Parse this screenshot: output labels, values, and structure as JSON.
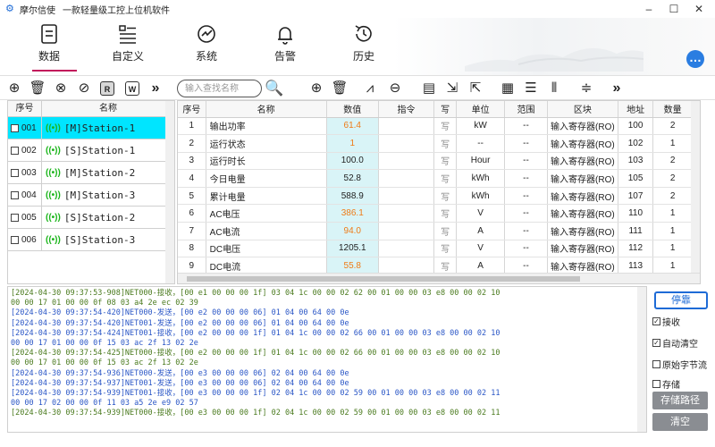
{
  "window": {
    "app_name": "摩尔信使",
    "subtitle": "一款轻量级工控上位机软件",
    "controls": [
      "–",
      "☐",
      "✕"
    ]
  },
  "nav": {
    "items": [
      {
        "label": "数据",
        "icon": "data-doc-icon",
        "active": true
      },
      {
        "label": "自定义",
        "icon": "custom-list-icon",
        "active": false
      },
      {
        "label": "系统",
        "icon": "system-gauge-icon",
        "active": false
      },
      {
        "label": "告警",
        "icon": "bell-icon",
        "active": false
      },
      {
        "label": "历史",
        "icon": "history-clock-icon",
        "active": false
      }
    ]
  },
  "toolbar": {
    "search_placeholder": "输入查找名称",
    "left_icons": [
      "add-icon",
      "delete-icon",
      "close-circle-icon",
      "check-circle-icon",
      "r-box-icon",
      "w-box-icon",
      "more-icon"
    ],
    "right_icons": [
      "add-icon",
      "delete-icon",
      "waveform-icon",
      "zoom-icon",
      "doc-icon",
      "import-icon",
      "export-icon",
      "grid-icon",
      "list-icon",
      "columns-icon",
      "sliders-icon",
      "more-icon"
    ]
  },
  "stations": {
    "headers": {
      "index": "序号",
      "name": "名称"
    },
    "rows": [
      {
        "index": "001",
        "name": "[M]Station-1",
        "selected": true
      },
      {
        "index": "002",
        "name": "[S]Station-1",
        "selected": false
      },
      {
        "index": "003",
        "name": "[M]Station-2",
        "selected": false
      },
      {
        "index": "004",
        "name": "[M]Station-3",
        "selected": false
      },
      {
        "index": "005",
        "name": "[S]Station-2",
        "selected": false
      },
      {
        "index": "006",
        "name": "[S]Station-3",
        "selected": false
      }
    ],
    "signal_glyph": "((•))"
  },
  "registers": {
    "headers": [
      "序号",
      "名称",
      "数值",
      "指令",
      "写",
      "单位",
      "范围",
      "区块",
      "地址",
      "数量"
    ],
    "rows": [
      {
        "no": "1",
        "name": "输出功率",
        "value": "61.4",
        "cmd": "",
        "write": "写",
        "unit": "kW",
        "range": "--",
        "block": "输入寄存器(RO)",
        "addr": "100",
        "qty": "2",
        "color": "orange"
      },
      {
        "no": "2",
        "name": "运行状态",
        "value": "1",
        "cmd": "",
        "write": "写",
        "unit": "--",
        "range": "--",
        "block": "输入寄存器(RO)",
        "addr": "102",
        "qty": "1",
        "color": "orange"
      },
      {
        "no": "3",
        "name": "运行时长",
        "value": "100.0",
        "cmd": "",
        "write": "写",
        "unit": "Hour",
        "range": "--",
        "block": "输入寄存器(RO)",
        "addr": "103",
        "qty": "2",
        "color": "dark"
      },
      {
        "no": "4",
        "name": "今日电量",
        "value": "52.8",
        "cmd": "",
        "write": "写",
        "unit": "kWh",
        "range": "--",
        "block": "输入寄存器(RO)",
        "addr": "105",
        "qty": "2",
        "color": "dark"
      },
      {
        "no": "5",
        "name": "累计电量",
        "value": "588.9",
        "cmd": "",
        "write": "写",
        "unit": "kWh",
        "range": "--",
        "block": "输入寄存器(RO)",
        "addr": "107",
        "qty": "2",
        "color": "dark"
      },
      {
        "no": "6",
        "name": "AC电压",
        "value": "386.1",
        "cmd": "",
        "write": "写",
        "unit": "V",
        "range": "--",
        "block": "输入寄存器(RO)",
        "addr": "110",
        "qty": "1",
        "color": "orange"
      },
      {
        "no": "7",
        "name": "AC电流",
        "value": "94.0",
        "cmd": "",
        "write": "写",
        "unit": "A",
        "range": "--",
        "block": "输入寄存器(RO)",
        "addr": "111",
        "qty": "1",
        "color": "orange"
      },
      {
        "no": "8",
        "name": "DC电压",
        "value": "1205.1",
        "cmd": "",
        "write": "写",
        "unit": "V",
        "range": "--",
        "block": "输入寄存器(RO)",
        "addr": "112",
        "qty": "1",
        "color": "dark"
      },
      {
        "no": "9",
        "name": "DC电流",
        "value": "55.8",
        "cmd": "",
        "write": "写",
        "unit": "A",
        "range": "--",
        "block": "输入寄存器(RO)",
        "addr": "113",
        "qty": "1",
        "color": "orange"
      }
    ]
  },
  "log": {
    "lines": [
      {
        "kind": "rx",
        "text": "[2024-04-30 09:37:53-908]NET000-接收，[00 e1 00 00 00 1f] 03 04 1c 00 00 02 62 00 01 00 00 03 e8 00 00 02 10"
      },
      {
        "kind": "rx",
        "text": "00 00 17 01 00 00 0f 08 03 a4 2e ec 02 39"
      },
      {
        "kind": "tx",
        "text": "[2024-04-30 09:37:54-420]NET000-发送，[00 e2 00 00 00 06] 01 04 00 64 00 0e"
      },
      {
        "kind": "tx",
        "text": "[2024-04-30 09:37:54-420]NET001-发送，[00 e2 00 00 00 06] 01 04 00 64 00 0e"
      },
      {
        "kind": "tx",
        "text": "[2024-04-30 09:37:54-424]NET001-接收，[00 e2 00 00 00 1f] 01 04 1c 00 00 02 66 00 01 00 00 03 e8 00 00 02 10"
      },
      {
        "kind": "tx",
        "text": "00 00 17 01 00 00 0f 15 03 ac 2f 13 02 2e"
      },
      {
        "kind": "rx",
        "text": "[2024-04-30 09:37:54-425]NET000-接收，[00 e2 00 00 00 1f] 01 04 1c 00 00 02 66 00 01 00 00 03 e8 00 00 02 10"
      },
      {
        "kind": "rx",
        "text": "00 00 17 01 00 00 0f 15 03 ac 2f 13 02 2e"
      },
      {
        "kind": "tx",
        "text": "[2024-04-30 09:37:54-936]NET000-发送，[00 e3 00 00 00 06] 02 04 00 64 00 0e"
      },
      {
        "kind": "tx",
        "text": "[2024-04-30 09:37:54-937]NET001-发送，[00 e3 00 00 00 06] 02 04 00 64 00 0e"
      },
      {
        "kind": "tx",
        "text": "[2024-04-30 09:37:54-939]NET001-接收，[00 e3 00 00 00 1f] 02 04 1c 00 00 02 59 00 01 00 00 03 e8 00 00 02 11"
      },
      {
        "kind": "tx",
        "text": "00 00 17 02 00 00 0f 11 03 a5 2e e9 02 57"
      },
      {
        "kind": "rx",
        "text": "[2024-04-30 09:37:54-939]NET000-接收，[00 e3 00 00 00 1f] 02 04 1c 00 00 02 59 00 01 00 00 03 e8 00 00 02 11"
      }
    ]
  },
  "side": {
    "stop_label": "停靠",
    "receive_label": "接收",
    "receive_checked": true,
    "auto_clear_label": "自动清空",
    "auto_clear_checked": true,
    "raw_bytes_label": "原始字节流",
    "raw_bytes_checked": false,
    "store_label": "存储",
    "store_checked": false,
    "store_path_label": "存储路径",
    "clear_label": "清空"
  },
  "colors": {
    "accent": "#1e6bd6",
    "selected_row": "#00e5ff",
    "value_orange": "#ef7b17",
    "value_bg": "#d9f4f7",
    "rx_text": "#4a7a1e",
    "tx_text": "#2a56c6",
    "active_nav_underline": "#c2185b"
  }
}
